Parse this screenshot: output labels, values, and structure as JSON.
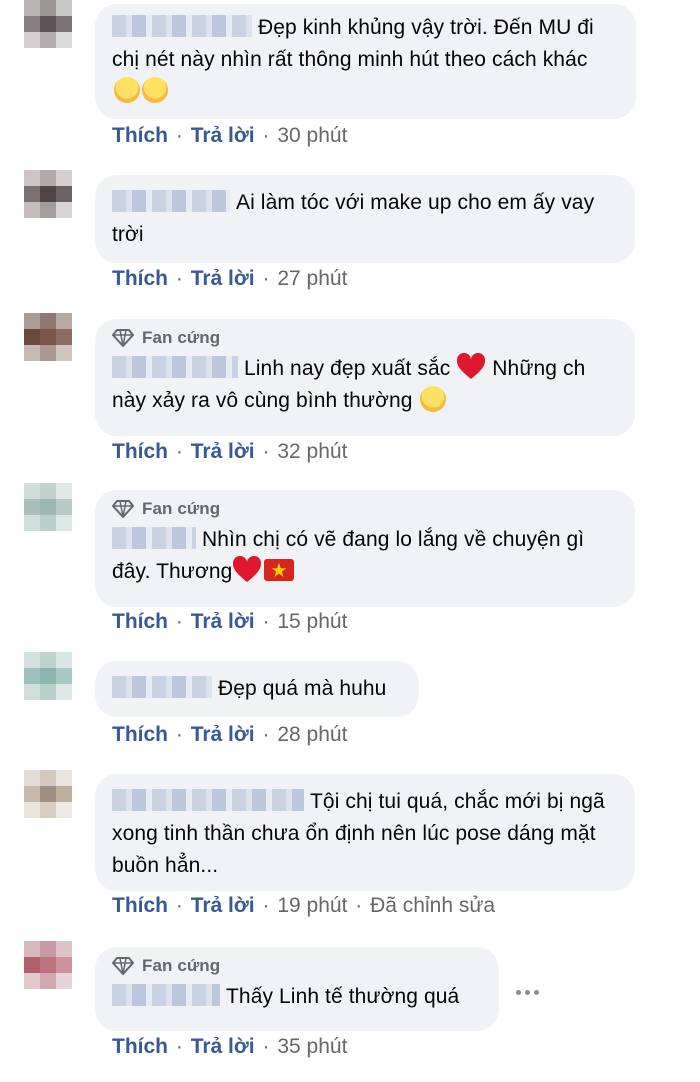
{
  "actions": {
    "like": "Thích",
    "reply": "Trả lời",
    "sep": "·",
    "edited": "Đã chỉnh sửa"
  },
  "comments": [
    {
      "badge": "",
      "text": "Đẹp kinh khủng vậy trời. Đến MU đi chị nét này nhìn rất thông minh hút theo cách khác",
      "time": "30 phút"
    },
    {
      "badge": "",
      "text": "Ai làm tóc với make up cho em ấy vay trời",
      "time": "27 phút"
    },
    {
      "badge": "Fan cứng",
      "text": "Linh nay đẹp xuất sắc",
      "text2": "Những ch này xảy ra vô cùng bình thường",
      "time": "32 phút"
    },
    {
      "badge": "Fan cứng",
      "text": "Nhìn chị có vẽ đang lo lắng về chuyện gì đây. Thương",
      "time": "15 phút"
    },
    {
      "badge": "",
      "text": "Đẹp quá mà huhu",
      "time": "28 phút"
    },
    {
      "badge": "",
      "text": "Tội chị tui quá, chắc mới bị ngã xong tinh thần chưa ổn định nên lúc pose dáng mặt buồn hẳn...",
      "time": "19 phút"
    },
    {
      "badge": "Fan cứng",
      "text": "Thấy Linh tế thường quá",
      "time": "35 phút"
    }
  ],
  "icons": {
    "badge": "diamond-icon",
    "more": "more-dots-icon",
    "heart": "heart-emoji",
    "flag": "vietnam-flag-emoji",
    "shock": "face-with-hand-over-mouth-emoji",
    "relieved": "relieved-face-emoji"
  },
  "colors": {
    "bubble": "#f0f2f5",
    "link": "#385898",
    "meta": "#65676b"
  }
}
